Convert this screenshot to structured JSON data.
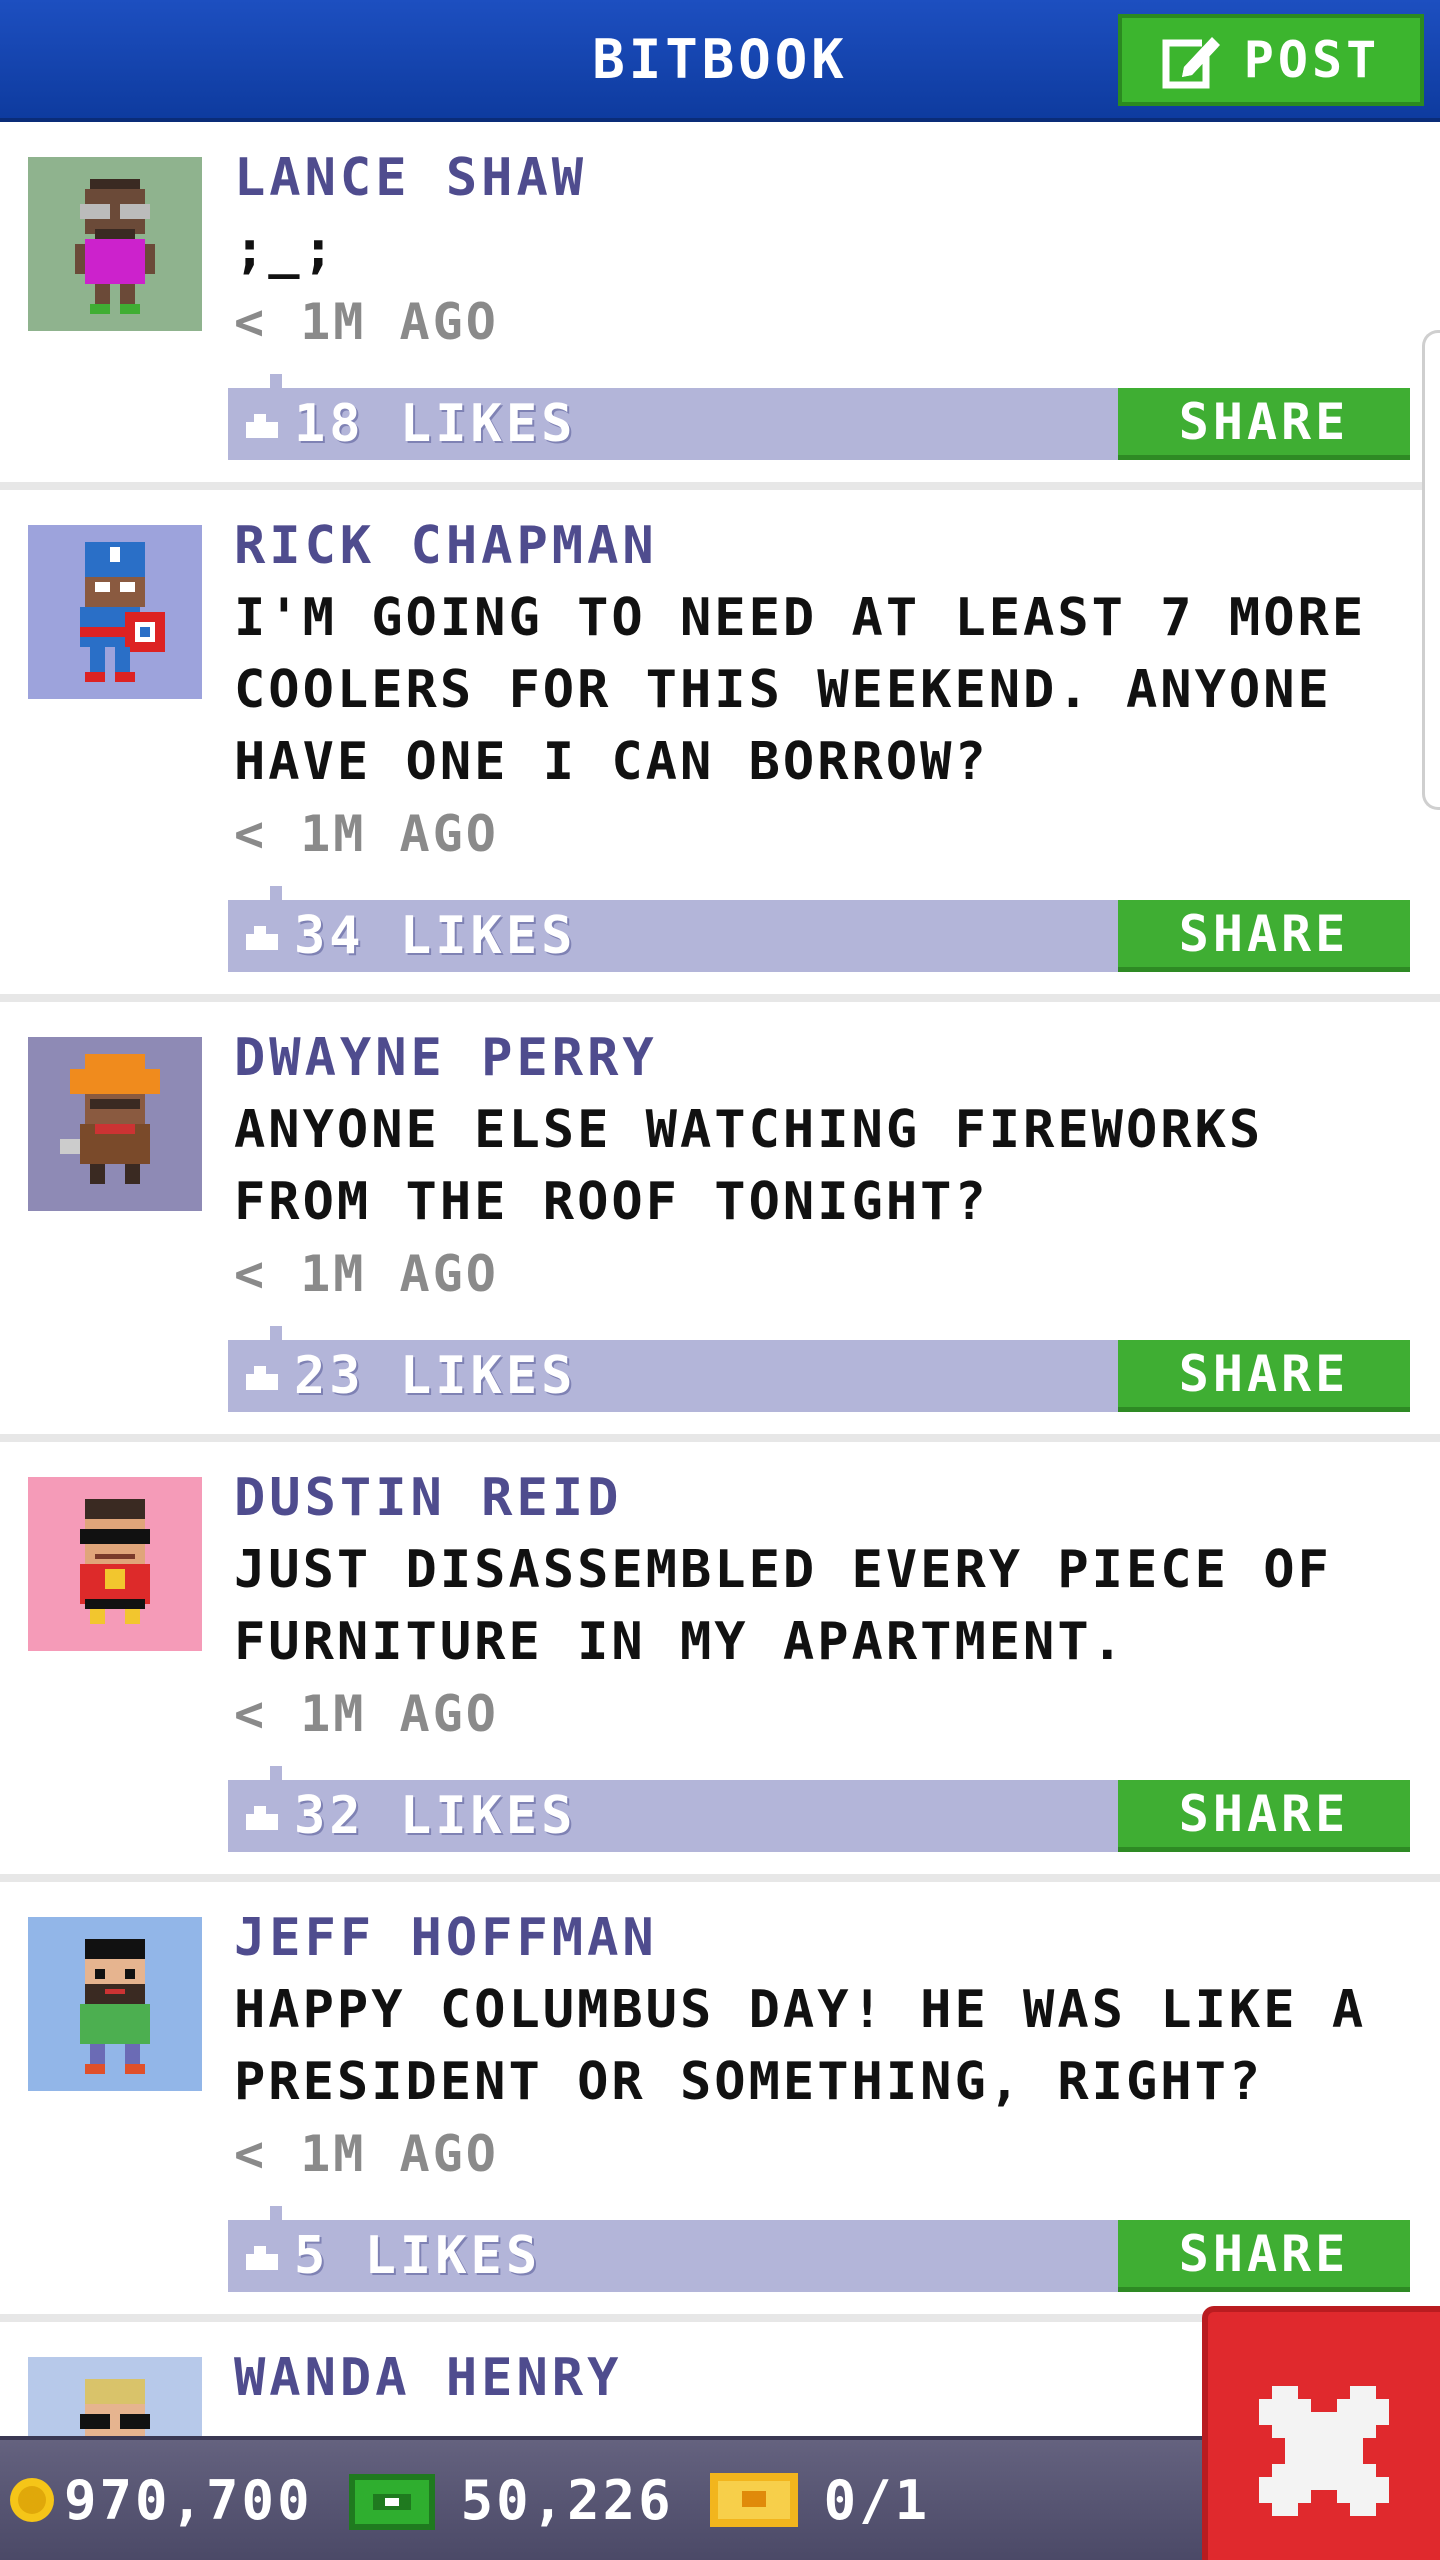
{
  "app": {
    "title": "BITBOOK",
    "post_label": "POST"
  },
  "colors": {
    "header_blue": "#1d4fc0",
    "green_button": "#3fae33",
    "like_bar": "#b3b5d9",
    "author_purple": "#4f4c8e",
    "close_red": "#e0292d"
  },
  "posts": [
    {
      "author": "LANCE SHAW",
      "message": ";_;",
      "time": "< 1M AGO",
      "likes": "18 LIKES",
      "share": "SHARE"
    },
    {
      "author": "RICK CHAPMAN",
      "message": "I'M GOING TO NEED AT LEAST 7 MORE\nCOOLERS FOR THIS WEEKEND. ANYONE\nHAVE ONE I CAN BORROW?",
      "time": "< 1M AGO",
      "likes": "34 LIKES",
      "share": "SHARE"
    },
    {
      "author": "DWAYNE PERRY",
      "message": "ANYONE ELSE WATCHING FIREWORKS\nFROM THE ROOF TONIGHT?",
      "time": "< 1M AGO",
      "likes": "23 LIKES",
      "share": "SHARE"
    },
    {
      "author": "DUSTIN REID",
      "message": "JUST DISASSEMBLED EVERY PIECE OF\nFURNITURE IN MY APARTMENT.",
      "time": "< 1M AGO",
      "likes": "32 LIKES",
      "share": "SHARE"
    },
    {
      "author": "JEFF HOFFMAN",
      "message": "HAPPY COLUMBUS DAY! HE WAS LIKE A\nPRESIDENT OR SOMETHING, RIGHT?",
      "time": "< 1M AGO",
      "likes": "5 LIKES",
      "share": "SHARE"
    },
    {
      "author": "WANDA HENRY"
    }
  ],
  "status_bar": {
    "coins": "970,700",
    "bux": "50,226",
    "tickets": "0/1"
  },
  "icons": {
    "post": "edit-icon",
    "like": "thumbs-up-icon",
    "coin": "coin-icon",
    "bux": "cash-icon",
    "ticket": "ticket-icon",
    "close": "close-icon"
  }
}
